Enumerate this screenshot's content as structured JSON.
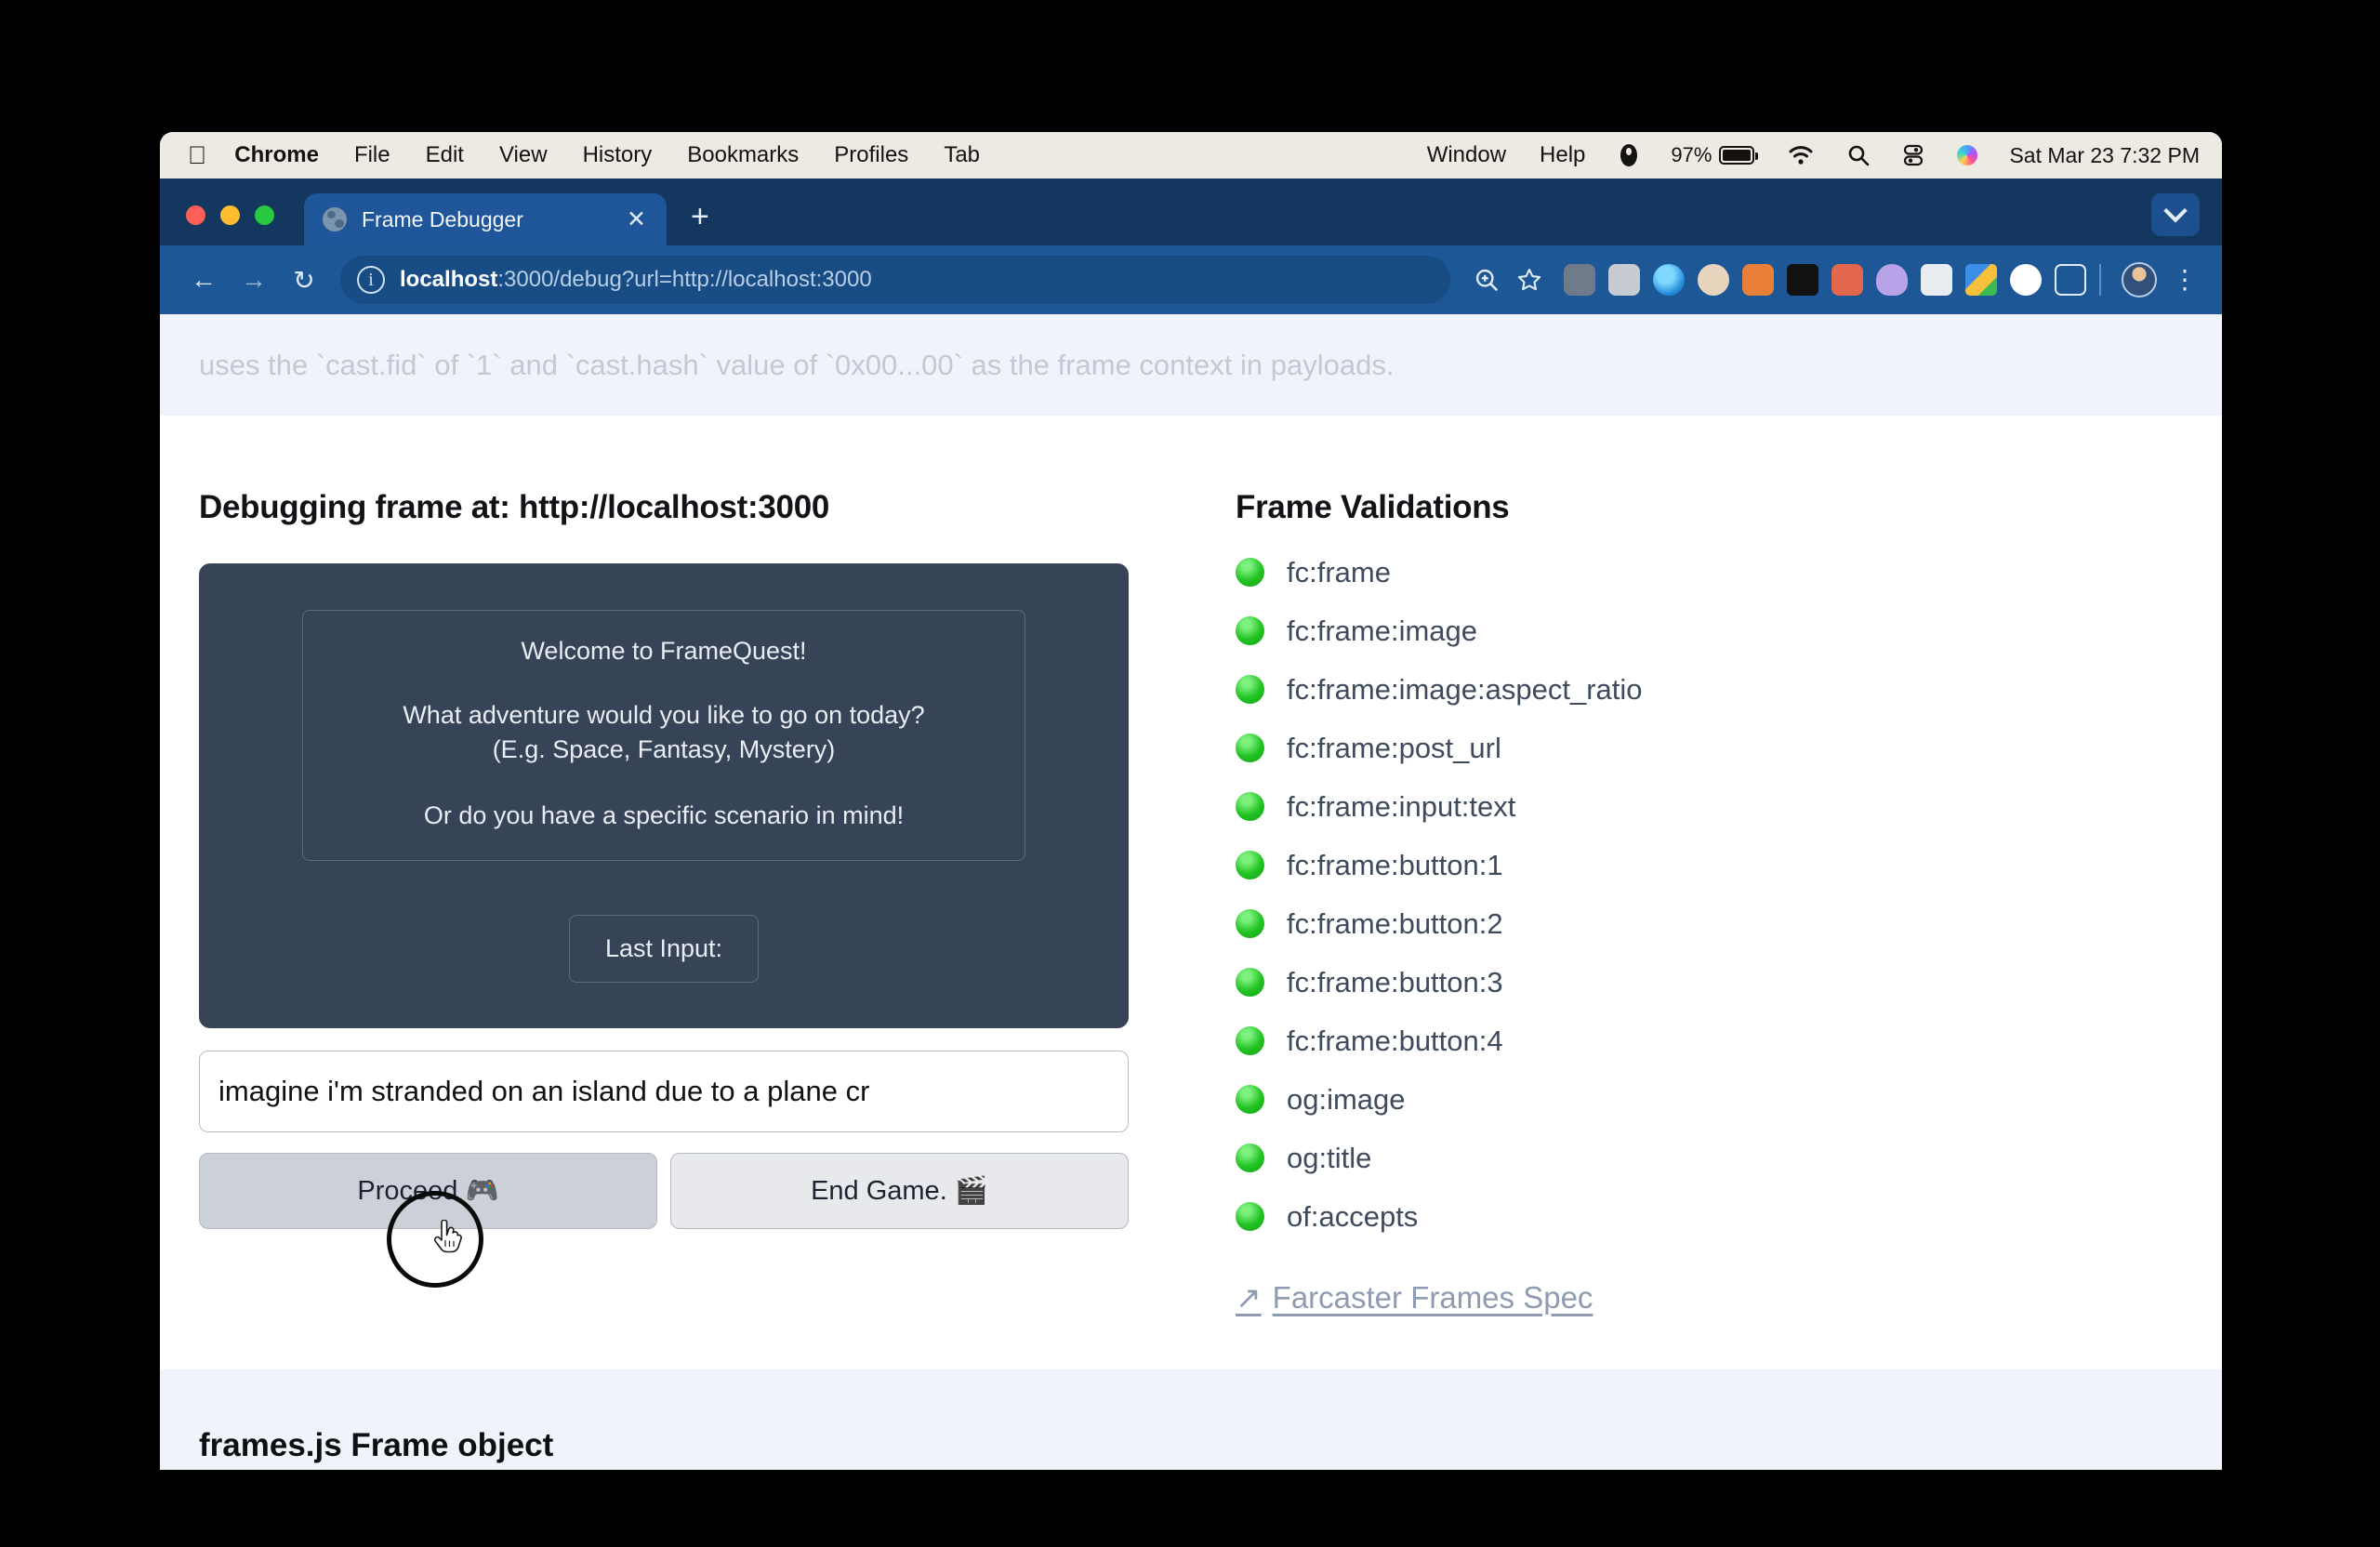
{
  "menubar": {
    "apple_glyph": "",
    "items": [
      {
        "label": "Chrome",
        "bold": true
      },
      {
        "label": "File",
        "bold": false
      },
      {
        "label": "Edit",
        "bold": false
      },
      {
        "label": "View",
        "bold": false
      },
      {
        "label": "History",
        "bold": false
      },
      {
        "label": "Bookmarks",
        "bold": false
      },
      {
        "label": "Profiles",
        "bold": false
      },
      {
        "label": "Tab",
        "bold": false
      }
    ],
    "right_items": [
      {
        "label": "Window"
      },
      {
        "label": "Help"
      }
    ],
    "battery_percent": "97%",
    "clock": "Sat Mar 23  7:32 PM",
    "icons": [
      "record-icon",
      "battery-icon",
      "wifi-icon",
      "search-icon",
      "control-center-icon",
      "siri-icon"
    ]
  },
  "tabstrip": {
    "tab_title": "Frame Debugger",
    "close_glyph": "✕",
    "new_tab_glyph": "+",
    "favicon_name": "globe-favicon"
  },
  "toolbar": {
    "back_glyph": "←",
    "forward_glyph": "→",
    "reload_glyph": "↻",
    "info_glyph": "i",
    "url_host": "localhost",
    "url_rest": ":3000/debug?url=http://localhost:3000",
    "zoom_glyph": "⌕",
    "bookmark_glyph": "☆",
    "kebab_glyph": "⋮",
    "extension_colors": [
      "#6f7b8a",
      "#c8ccd2",
      "#29a3d8",
      "#e8d5bd",
      "#e8803a",
      "#111111",
      "#e2674c",
      "#b9a3e8",
      "#e9edf2",
      "#f2c14a",
      "#ffffff",
      "#ffffff"
    ]
  },
  "page": {
    "faded_top_text": "uses the `cast.fid` of `1` and `cast.hash` value of `0x00...00` as the frame context in payloads.",
    "debug_title": "Debugging frame at: http://localhost:3000",
    "frame": {
      "line1": "Welcome to FrameQuest!",
      "line2": "What adventure would you like to go on today?",
      "line3": "(E.g. Space, Fantasy, Mystery)",
      "line4": "Or do you have a specific scenario in mind!",
      "last_input_label": "Last Input:"
    },
    "input_value": "imagine i'm stranded on an island due to a plane cr",
    "buttons": [
      {
        "label": "Proceed 🎮",
        "state": "hover"
      },
      {
        "label": "End Game. 🎬",
        "state": "normal"
      }
    ],
    "bottom_cut_text": "frames.js Frame object"
  },
  "validations": {
    "title": "Frame Validations",
    "status_color": "#22c322",
    "items": [
      {
        "label": "fc:frame",
        "status": "pass"
      },
      {
        "label": "fc:frame:image",
        "status": "pass"
      },
      {
        "label": "fc:frame:image:aspect_ratio",
        "status": "pass"
      },
      {
        "label": "fc:frame:post_url",
        "status": "pass"
      },
      {
        "label": "fc:frame:input:text",
        "status": "pass"
      },
      {
        "label": "fc:frame:button:1",
        "status": "pass"
      },
      {
        "label": "fc:frame:button:2",
        "status": "pass"
      },
      {
        "label": "fc:frame:button:3",
        "status": "pass"
      },
      {
        "label": "fc:frame:button:4",
        "status": "pass"
      },
      {
        "label": "og:image",
        "status": "pass"
      },
      {
        "label": "og:title",
        "status": "pass"
      },
      {
        "label": "of:accepts",
        "status": "pass"
      }
    ],
    "spec_link": "Farcaster Frames Spec",
    "spec_link_glyph": "↗"
  }
}
